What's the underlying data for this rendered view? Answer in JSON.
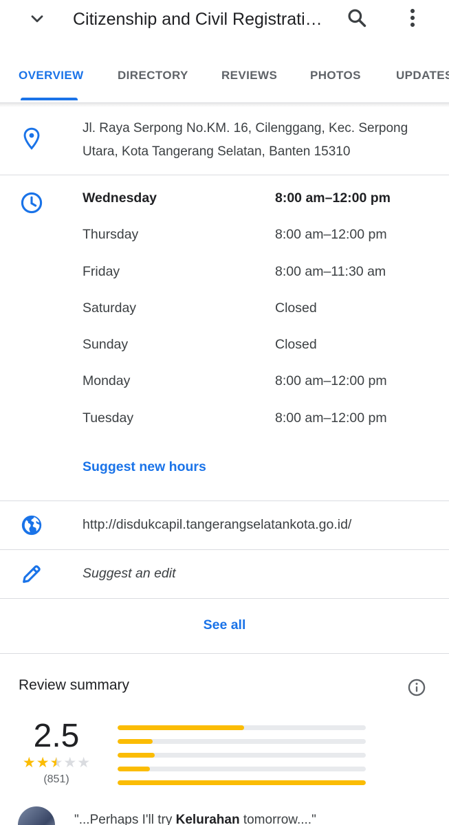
{
  "header": {
    "title": "Citizenship and Civil Registrati…",
    "back_icon": "chevron-down-icon",
    "search_icon": "search-icon",
    "more_icon": "more-vert-icon"
  },
  "tabs": [
    {
      "label": "OVERVIEW",
      "active": true
    },
    {
      "label": "DIRECTORY"
    },
    {
      "label": "REVIEWS"
    },
    {
      "label": "PHOTOS"
    },
    {
      "label": "UPDATES"
    }
  ],
  "address": {
    "line1": "Jl. Raya Serpong No.KM. 16, Cilenggang, Kec. Serpong",
    "line2": "Utara, Kota Tangerang Selatan, Banten 15310"
  },
  "hours": [
    {
      "day": "Wednesday",
      "time": "8:00 am–12:00 pm",
      "today": true
    },
    {
      "day": "Thursday",
      "time": "8:00 am–12:00 pm"
    },
    {
      "day": "Friday",
      "time": "8:00 am–11:30 am"
    },
    {
      "day": "Saturday",
      "time": "Closed"
    },
    {
      "day": "Sunday",
      "time": "Closed"
    },
    {
      "day": "Monday",
      "time": "8:00 am–12:00 pm"
    },
    {
      "day": "Tuesday",
      "time": "8:00 am–12:00 pm"
    }
  ],
  "suggest_hours": "Suggest new hours",
  "website": "http://disdukcapil.tangerangselatankota.go.id/",
  "suggest_edit": "Suggest an edit",
  "see_all": "See all",
  "review_summary": {
    "title": "Review summary",
    "rating": "2.5",
    "stars": 2.5,
    "count": "(851)",
    "distribution": [
      {
        "stars": 5,
        "fraction": 0.51
      },
      {
        "stars": 4,
        "fraction": 0.14
      },
      {
        "stars": 3,
        "fraction": 0.15
      },
      {
        "stars": 2,
        "fraction": 0.13
      },
      {
        "stars": 1,
        "fraction": 1.0
      }
    ],
    "bar_color": "#fbbc04",
    "snippet_prefix": "\"...Perhaps I'll try ",
    "snippet_bold": "Kelurahan",
    "snippet_suffix": " tomorrow....\""
  },
  "colors": {
    "accent": "#1a73e8",
    "star": "#fbbc04"
  }
}
